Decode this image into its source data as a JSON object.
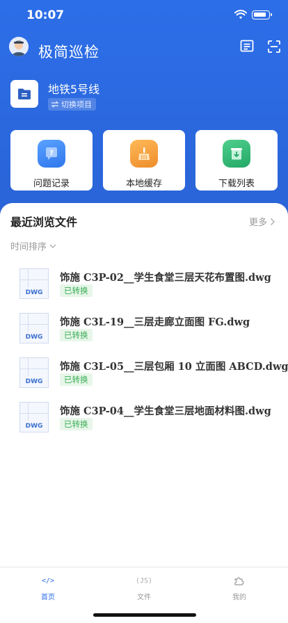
{
  "status_bar": {
    "time": "10:07"
  },
  "header": {
    "title": "极简巡检"
  },
  "project": {
    "name": "地铁5号线",
    "switch_label": "切换项目"
  },
  "quick_actions": [
    {
      "label": "问题记录",
      "icon": "question-icon",
      "color": "#3b82f0"
    },
    {
      "label": "本地缓存",
      "icon": "broom-icon",
      "color": "#f2a03d"
    },
    {
      "label": "下载列表",
      "icon": "download-box-icon",
      "color": "#2fb574"
    }
  ],
  "recent": {
    "title": "最近浏览文件",
    "more_label": "更多",
    "sort_label": "时间排序",
    "files": [
      {
        "name": "饰施 C3P-02__学生食堂三层天花布置图.dwg",
        "type": "DWG",
        "status": "已转换"
      },
      {
        "name": "饰施 C3L-19__三层走廊立面图 FG.dwg",
        "type": "DWG",
        "status": "已转换"
      },
      {
        "name": "饰施 C3L-05__三层包厢 10 立面图 ABCD.dwg",
        "type": "DWG",
        "status": "已转换"
      },
      {
        "name": "饰施 C3P-04__学生食堂三层地面材料图.dwg",
        "type": "DWG",
        "status": "已转换"
      }
    ]
  },
  "tabs": [
    {
      "label": "首页",
      "icon_text": "</>",
      "active": true
    },
    {
      "label": "文件",
      "icon_text": "(JS)",
      "active": false
    },
    {
      "label": "我的",
      "icon_text": "",
      "active": false
    }
  ],
  "colors": {
    "primary": "#2c6ee8",
    "success": "#3aae56"
  }
}
